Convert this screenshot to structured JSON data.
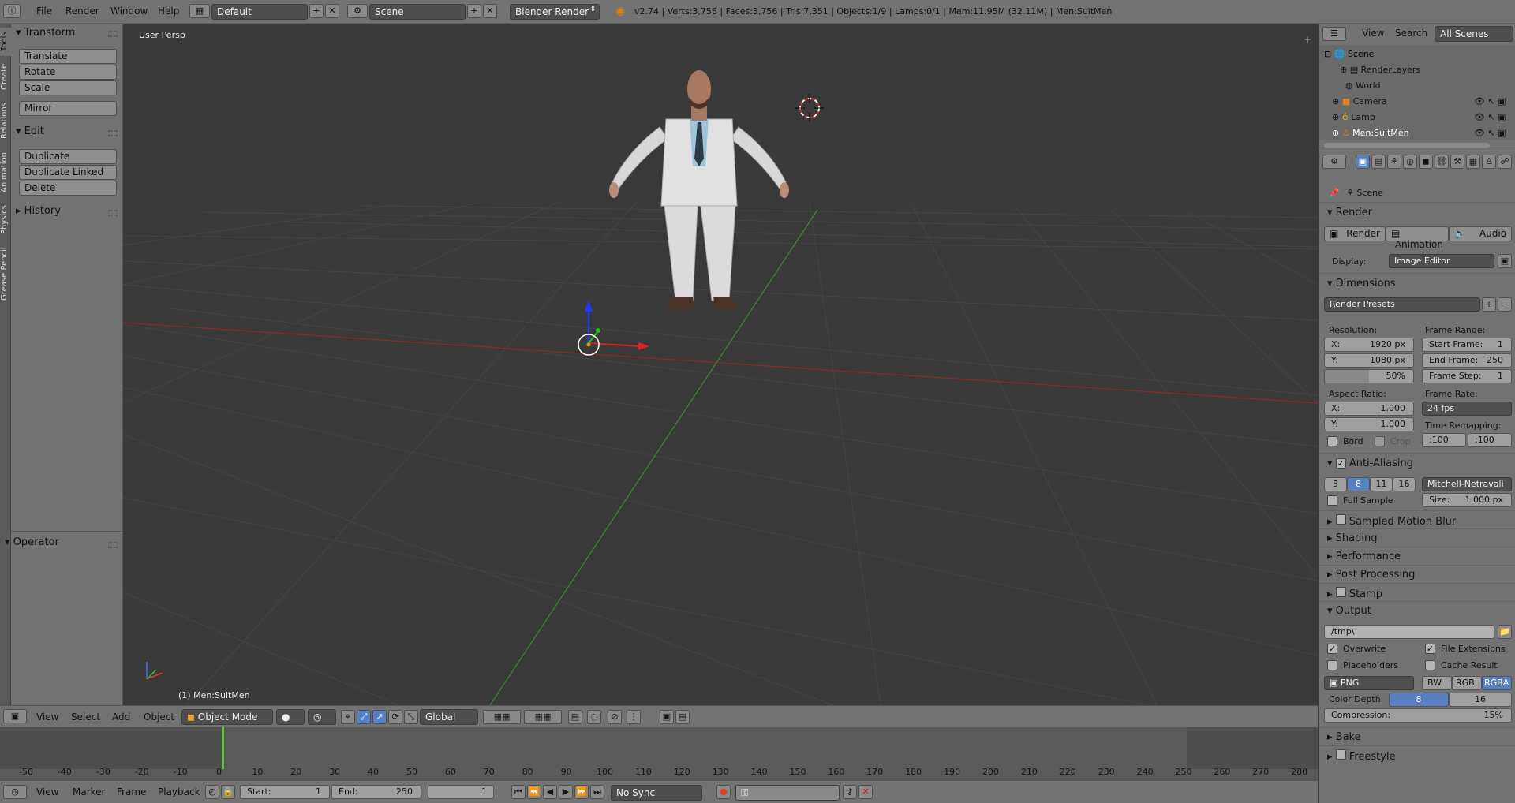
{
  "topbar": {
    "menus": [
      "File",
      "Render",
      "Window",
      "Help"
    ],
    "layout": "Default",
    "scene": "Scene",
    "engine": "Blender Render",
    "stats": "v2.74 | Verts:3,756 | Faces:3,756 | Tris:7,351 | Objects:1/9 | Lamps:0/1 | Mem:11.95M (32.11M) | Men:SuitMen"
  },
  "lefttabs": [
    "Tools",
    "Create",
    "Relations",
    "Animation",
    "Physics",
    "Grease Pencil"
  ],
  "toolshelf": {
    "transform_title": "Transform",
    "translate": "Translate",
    "rotate": "Rotate",
    "scale": "Scale",
    "mirror": "Mirror",
    "edit_title": "Edit",
    "duplicate": "Duplicate",
    "duplicate_linked": "Duplicate Linked",
    "delete": "Delete",
    "history_title": "History",
    "operator_title": "Operator"
  },
  "viewport": {
    "view_label": "User Persp",
    "object_label": "(1) Men:SuitMen"
  },
  "viewheader": {
    "menus": [
      "View",
      "Select",
      "Add",
      "Object"
    ],
    "mode": "Object Mode",
    "orientation": "Global"
  },
  "timeline": {
    "ticks": [
      "-50",
      "-40",
      "-30",
      "-20",
      "-10",
      "0",
      "10",
      "20",
      "30",
      "40",
      "50",
      "60",
      "70",
      "80",
      "90",
      "100",
      "110",
      "120",
      "130",
      "140",
      "150",
      "160",
      "170",
      "180",
      "190",
      "200",
      "210",
      "220",
      "230",
      "240",
      "250",
      "260",
      "270",
      "280"
    ],
    "menus": [
      "View",
      "Marker",
      "Frame",
      "Playback"
    ],
    "start_label": "Start:",
    "start_value": "1",
    "end_label": "End:",
    "end_value": "250",
    "current": "1",
    "sync": "No Sync"
  },
  "outliner": {
    "menus": [
      "View",
      "Search"
    ],
    "filter": "All Scenes",
    "items": [
      "Scene",
      "RenderLayers",
      "World",
      "Camera",
      "Lamp",
      "Men:SuitMen"
    ]
  },
  "props": {
    "context": "Scene",
    "render_title": "Render",
    "render_btn": "Render",
    "animation_btn": "Animation",
    "audio_btn": "Audio",
    "display_label": "Display:",
    "display_value": "Image Editor",
    "dimensions_title": "Dimensions",
    "render_presets": "Render Presets",
    "resolution_label": "Resolution:",
    "res_x": "X:",
    "res_x_val": "1920 px",
    "res_y": "Y:",
    "res_y_val": "1080 px",
    "res_pct": "50%",
    "frame_range_label": "Frame Range:",
    "start_frame": "Start Frame:",
    "start_frame_val": "1",
    "end_frame": "End Frame:",
    "end_frame_val": "250",
    "frame_step": "Frame Step:",
    "frame_step_val": "1",
    "aspect_label": "Aspect Ratio:",
    "asp_x": "X:",
    "asp_x_val": "1.000",
    "asp_y": "Y:",
    "asp_y_val": "1.000",
    "frame_rate_label": "Frame Rate:",
    "frame_rate": "24 fps",
    "time_remap_label": "Time Remapping:",
    "remap_old": ":100",
    "remap_new": ":100",
    "bord": "Bord",
    "crop": "Crop",
    "aa_title": "Anti-Aliasing",
    "aa_samples": [
      "5",
      "8",
      "11",
      "16"
    ],
    "aa_filter": "Mitchell-Netravali",
    "full_sample": "Full Sample",
    "size_label": "Size:",
    "size_val": "1.000 px",
    "motion_blur": "Sampled Motion Blur",
    "shading": "Shading",
    "performance": "Performance",
    "post_processing": "Post Processing",
    "stamp": "Stamp",
    "output_title": "Output",
    "output_path": "/tmp\\",
    "overwrite": "Overwrite",
    "file_ext": "File Extensions",
    "placeholders": "Placeholders",
    "cache_result": "Cache Result",
    "format": "PNG",
    "bw": "BW",
    "rgb": "RGB",
    "rgba": "RGBA",
    "color_depth_label": "Color Depth:",
    "depth_8": "8",
    "depth_16": "16",
    "compression_label": "Compression:",
    "compression_val": "15%",
    "bake": "Bake",
    "freestyle": "Freestyle"
  }
}
